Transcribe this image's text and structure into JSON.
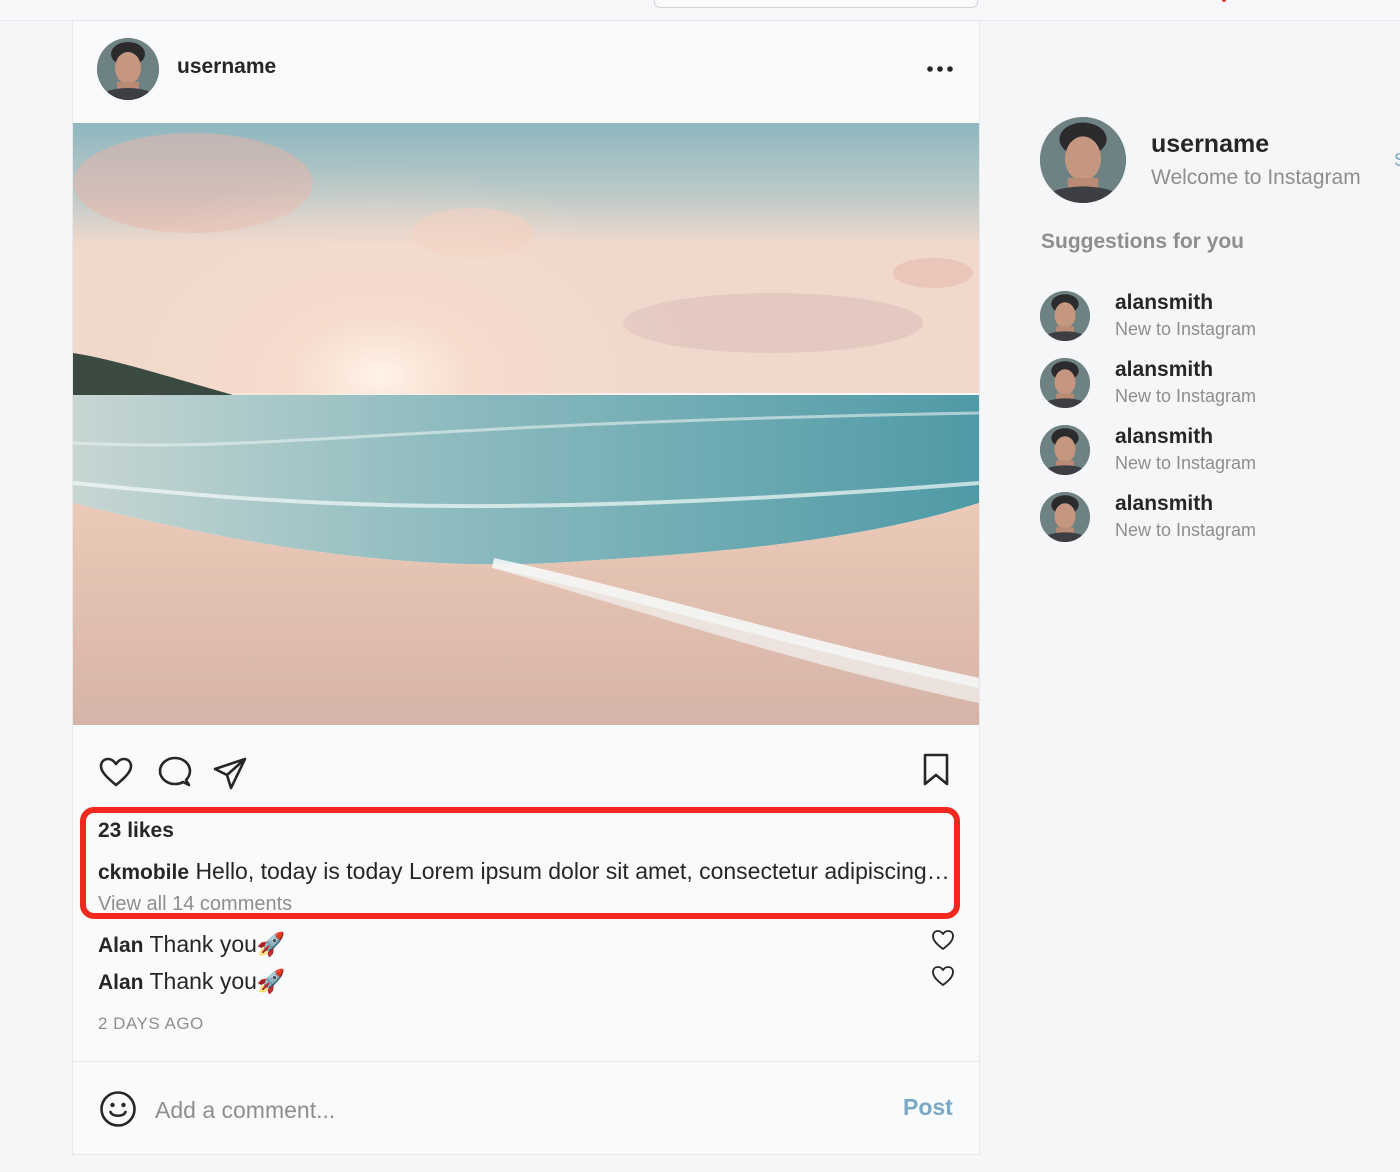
{
  "post": {
    "username": "username",
    "likes": "23 likes",
    "caption_user": "ckmobile",
    "caption_text": "Hello, today is today Lorem ipsum dolor sit amet, consectetur adipiscing elit",
    "view_comments": "View all 14 comments",
    "comments": [
      {
        "user": "Alan",
        "text": "Thank you🚀"
      },
      {
        "user": "Alan",
        "text": "Thank you🚀"
      }
    ],
    "timestamp": "2 DAYS AGO",
    "comment_placeholder": "Add a comment...",
    "post_label": "Post"
  },
  "sidebar": {
    "username": "username",
    "subtitle": "Welcome to Instagram",
    "switch_label": "S",
    "suggestions_title": "Suggestions for you",
    "suggestions": [
      {
        "name": "alansmith",
        "sub": "New to Instagram"
      },
      {
        "name": "alansmith",
        "sub": "New to Instagram"
      },
      {
        "name": "alansmith",
        "sub": "New to Instagram"
      },
      {
        "name": "alansmith",
        "sub": "New to Instagram"
      }
    ]
  },
  "icons": {
    "more": "more-horizontal-icon",
    "like": "heart-icon",
    "comment": "comment-icon",
    "share": "paper-plane-icon",
    "save": "bookmark-icon",
    "emoji": "smiley-icon"
  },
  "colors": {
    "highlight": "#f0281d",
    "post_button": "#7aa9c6",
    "muted_text": "#8e8e8e"
  }
}
